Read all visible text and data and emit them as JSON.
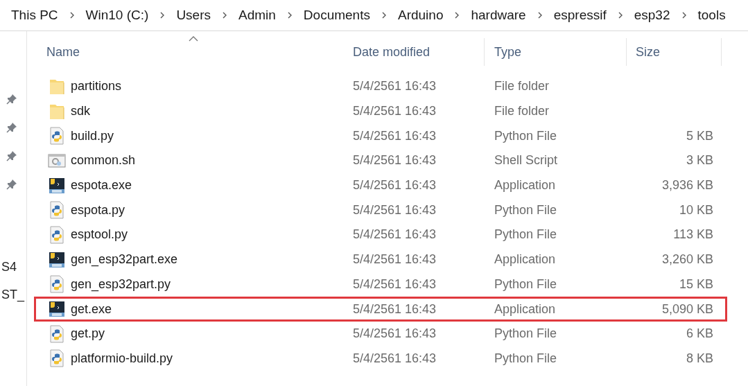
{
  "breadcrumb": [
    "This PC",
    "Win10 (C:)",
    "Users",
    "Admin",
    "Documents",
    "Arduino",
    "hardware",
    "espressif",
    "esp32",
    "tools"
  ],
  "sidebar": {
    "items": [
      {
        "kind": "pin"
      },
      {
        "kind": "pin"
      },
      {
        "kind": "pin"
      },
      {
        "kind": "pin"
      },
      {
        "kind": "text",
        "label": "S4"
      },
      {
        "kind": "text",
        "label": "ST_"
      }
    ]
  },
  "table": {
    "columns": [
      {
        "label": "Name",
        "sorted": true
      },
      {
        "label": "Date modified",
        "sorted": false
      },
      {
        "label": "Type",
        "sorted": false
      },
      {
        "label": "Size",
        "sorted": false
      }
    ],
    "rows": [
      {
        "kind": "folder",
        "name": "partitions",
        "date": "5/4/2561 16:43",
        "type": "File folder",
        "size": "",
        "highlighted": false
      },
      {
        "kind": "folder",
        "name": "sdk",
        "date": "5/4/2561 16:43",
        "type": "File folder",
        "size": "",
        "highlighted": false
      },
      {
        "kind": "python",
        "name": "build.py",
        "date": "5/4/2561 16:43",
        "type": "Python File",
        "size": "5 KB",
        "highlighted": false
      },
      {
        "kind": "shell",
        "name": "common.sh",
        "date": "5/4/2561 16:43",
        "type": "Shell Script",
        "size": "3 KB",
        "highlighted": false
      },
      {
        "kind": "exe",
        "name": "espota.exe",
        "date": "5/4/2561 16:43",
        "type": "Application",
        "size": "3,936 KB",
        "highlighted": false
      },
      {
        "kind": "python",
        "name": "espota.py",
        "date": "5/4/2561 16:43",
        "type": "Python File",
        "size": "10 KB",
        "highlighted": false
      },
      {
        "kind": "python",
        "name": "esptool.py",
        "date": "5/4/2561 16:43",
        "type": "Python File",
        "size": "113 KB",
        "highlighted": false
      },
      {
        "kind": "exe",
        "name": "gen_esp32part.exe",
        "date": "5/4/2561 16:43",
        "type": "Application",
        "size": "3,260 KB",
        "highlighted": false
      },
      {
        "kind": "python",
        "name": "gen_esp32part.py",
        "date": "5/4/2561 16:43",
        "type": "Python File",
        "size": "15 KB",
        "highlighted": false
      },
      {
        "kind": "exe",
        "name": "get.exe",
        "date": "5/4/2561 16:43",
        "type": "Application",
        "size": "5,090 KB",
        "highlighted": true
      },
      {
        "kind": "python",
        "name": "get.py",
        "date": "5/4/2561 16:43",
        "type": "Python File",
        "size": "6 KB",
        "highlighted": false
      },
      {
        "kind": "python",
        "name": "platformio-build.py",
        "date": "5/4/2561 16:43",
        "type": "Python File",
        "size": "8 KB",
        "highlighted": false
      }
    ]
  }
}
